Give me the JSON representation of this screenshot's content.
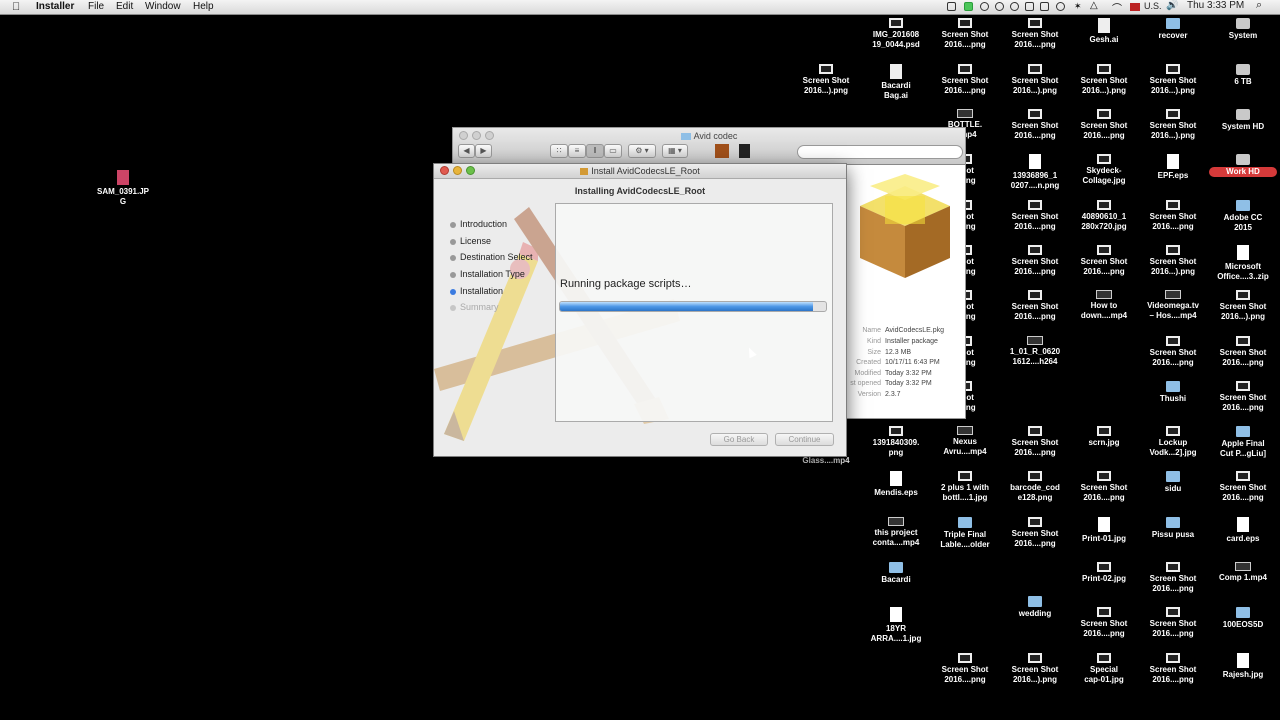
{
  "menubar": {
    "apple_glyph": "",
    "app_name": "Installer",
    "menus": [
      "File",
      "Edit",
      "Window",
      "Help"
    ],
    "input_source": "U.S.",
    "clock": "Thu 3:33 PM"
  },
  "desktop_left_icon": {
    "label": "SAM_0391.JPG"
  },
  "desktop_icons": [
    {
      "label": "IMG_201608\n19_0044.psd",
      "kind": "img"
    },
    {
      "label": "Screen Shot\n2016....png",
      "kind": "img"
    },
    {
      "label": "Screen Shot\n2016....png",
      "kind": "img"
    },
    {
      "label": "Gesh.ai",
      "kind": "ai"
    },
    {
      "label": "recover",
      "kind": "folder"
    },
    {
      "label": "System",
      "kind": "drive"
    },
    {
      "label": "Screen Shot\n2016...).png",
      "kind": "img"
    },
    {
      "label": "Bacardi\nBag.ai",
      "kind": "ai"
    },
    {
      "label": "Screen Shot\n2016....png",
      "kind": "img"
    },
    {
      "label": "Screen Shot\n2016...).png",
      "kind": "img"
    },
    {
      "label": "Screen Shot\n2016...).png",
      "kind": "img"
    },
    {
      "label": "Screen Shot\n2016...).png",
      "kind": "img"
    },
    {
      "label": "6 TB",
      "kind": "drive"
    },
    {
      "label": "BOTTLE.\n...mp4",
      "kind": "vid"
    },
    {
      "label": "Screen Shot\n2016....png",
      "kind": "img"
    },
    {
      "label": "Screen Shot\n2016....png",
      "kind": "img"
    },
    {
      "label": "Screen Shot\n2016...).png",
      "kind": "img"
    },
    {
      "label": "System HD",
      "kind": "drive"
    },
    {
      "label": "Shot\n...png",
      "kind": "img"
    },
    {
      "label": "13936896_1\n0207....n.png",
      "kind": "doc"
    },
    {
      "label": "Skydeck-\nCollage.jpg",
      "kind": "img"
    },
    {
      "label": "EPF.eps",
      "kind": "doc"
    },
    {
      "label": "Work HD",
      "kind": "drive"
    },
    {
      "label": "Shot\n...png",
      "kind": "img"
    },
    {
      "label": "Screen Shot\n2016....png",
      "kind": "img"
    },
    {
      "label": "40890610_1\n280x720.jpg",
      "kind": "img"
    },
    {
      "label": "Screen Shot\n2016....png",
      "kind": "img"
    },
    {
      "label": "Adobe CC\n2015",
      "kind": "folder"
    },
    {
      "label": "Shot\n...png",
      "kind": "img"
    },
    {
      "label": "Screen Shot\n2016....png",
      "kind": "img"
    },
    {
      "label": "Screen Shot\n2016....png",
      "kind": "img"
    },
    {
      "label": "Screen Shot\n2016...).png",
      "kind": "img"
    },
    {
      "label": "Microsoft\nOffice....3..zip",
      "kind": "doc"
    },
    {
      "label": "Shot\n...png",
      "kind": "img"
    },
    {
      "label": "Screen Shot\n2016....png",
      "kind": "img"
    },
    {
      "label": "How to\ndown....mp4",
      "kind": "vid"
    },
    {
      "label": "Videomega.tv\n– Hos....mp4",
      "kind": "vid"
    },
    {
      "label": "Screen Shot\n2016...).png",
      "kind": "img"
    },
    {
      "label": "Shot\n...png",
      "kind": "img"
    },
    {
      "label": "1_01_R_0620\n1612....h264",
      "kind": "vid"
    },
    {
      "label": "Screen Shot\n2016....png",
      "kind": "img"
    },
    {
      "label": "Screen Shot\n2016....png",
      "kind": "img"
    },
    {
      "label": "Shot\n...png",
      "kind": "img"
    },
    {
      "label": "Thushi",
      "kind": "folder"
    },
    {
      "label": "Screen Shot\n2016....png",
      "kind": "img"
    },
    {
      "label": "Glass....mp4",
      "kind": "vid"
    },
    {
      "label": "1391840309.\npng",
      "kind": "img"
    },
    {
      "label": "Nexus\nAvru....mp4",
      "kind": "vid"
    },
    {
      "label": "Screen Shot\n2016....png",
      "kind": "img"
    },
    {
      "label": "scrn.jpg",
      "kind": "img"
    },
    {
      "label": "Lockup\nVodk...2].jpg",
      "kind": "img"
    },
    {
      "label": "Apple Final\nCut P...gLiu]",
      "kind": "folder"
    },
    {
      "label": "Mendis.eps",
      "kind": "doc"
    },
    {
      "label": "2 plus 1 with\nbottl....1.jpg",
      "kind": "img"
    },
    {
      "label": "barcode_cod\ne128.png",
      "kind": "img"
    },
    {
      "label": "Screen Shot\n2016....png",
      "kind": "img"
    },
    {
      "label": "sidu",
      "kind": "folder"
    },
    {
      "label": "Screen Shot\n2016....png",
      "kind": "img"
    },
    {
      "label": "this project\nconta....mp4",
      "kind": "vid"
    },
    {
      "label": "Triple Final\nLable....older",
      "kind": "folder"
    },
    {
      "label": "Screen Shot\n2016....png",
      "kind": "img"
    },
    {
      "label": "Print-01.jpg",
      "kind": "doc"
    },
    {
      "label": "Pissu pusa",
      "kind": "folder"
    },
    {
      "label": "card.eps",
      "kind": "doc"
    },
    {
      "label": "Bacardi",
      "kind": "folder"
    },
    {
      "label": "Print-02.jpg",
      "kind": "img"
    },
    {
      "label": "Screen Shot\n2016....png",
      "kind": "img"
    },
    {
      "label": "Comp 1.mp4",
      "kind": "vid"
    },
    {
      "label": "wedding",
      "kind": "folder"
    },
    {
      "label": "18YR\nARRA....1.jpg",
      "kind": "doc"
    },
    {
      "label": "Screen Shot\n2016....png",
      "kind": "img"
    },
    {
      "label": "Screen Shot\n2016....png",
      "kind": "img"
    },
    {
      "label": "100EOS5D",
      "kind": "folder"
    },
    {
      "label": "Screen Shot\n2016....png",
      "kind": "img"
    },
    {
      "label": "Screen Shot\n2016...).png",
      "kind": "img"
    },
    {
      "label": "Special\ncap-01.jpg",
      "kind": "img"
    },
    {
      "label": "Screen Shot\n2016....png",
      "kind": "img"
    },
    {
      "label": "Rajesh.jpg",
      "kind": "doc"
    }
  ],
  "finder": {
    "title": "Avid codec",
    "info": {
      "name_key": "Name",
      "name_val": "AvidCodecsLE.pkg",
      "kind_key": "Kind",
      "kind_val": "Installer package",
      "size_key": "Size",
      "size_val": "12.3 MB",
      "created_key": "Created",
      "created_val": "10/17/11 6:43 PM",
      "modified_key": "Modified",
      "modified_val": "Today 3:32 PM",
      "opened_key": "st opened",
      "opened_val": "Today 3:32 PM",
      "version_key": "Version",
      "version_val": "2.3.7"
    }
  },
  "installer": {
    "window_title": "Install AvidCodecsLE_Root",
    "heading": "Installing AvidCodecsLE_Root",
    "steps": [
      "Introduction",
      "License",
      "Destination Select",
      "Installation Type",
      "Installation",
      "Summary"
    ],
    "status_text": "Running package scripts…",
    "progress": 0.95,
    "go_back_label": "Go Back",
    "continue_label": "Continue"
  },
  "colors": {
    "accent": "#3b7be0",
    "desktop": "#000000"
  }
}
